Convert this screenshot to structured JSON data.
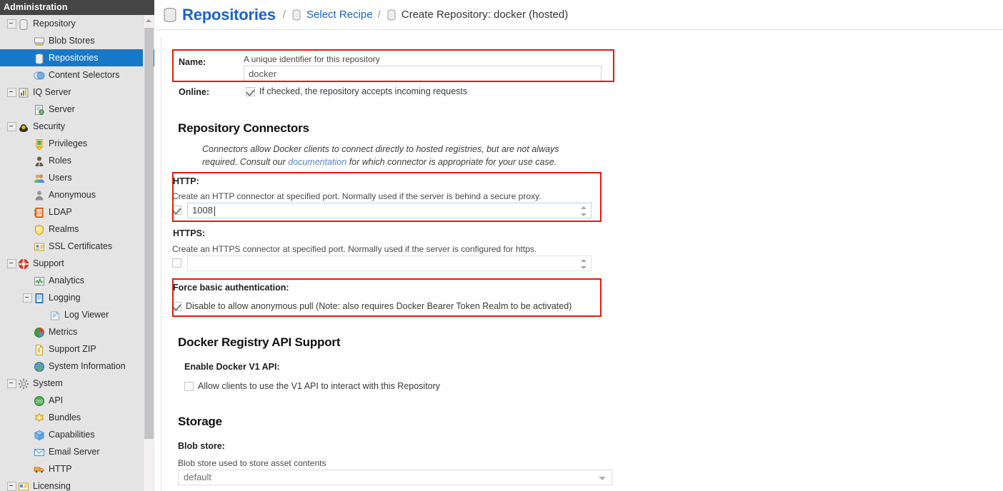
{
  "sidebar": {
    "header_title": "Administration",
    "items": [
      {
        "label": "Repository",
        "icon": "database-icon",
        "indent": 0,
        "twisty": "minus",
        "selected": false
      },
      {
        "label": "Blob Stores",
        "icon": "blob-store-icon",
        "indent": 1,
        "twisty": "none",
        "selected": false
      },
      {
        "label": "Repositories",
        "icon": "database-icon",
        "indent": 1,
        "twisty": "none",
        "selected": true
      },
      {
        "label": "Content Selectors",
        "icon": "content-selector-icon",
        "indent": 1,
        "twisty": "none",
        "selected": false
      },
      {
        "label": "IQ Server",
        "icon": "iq-server-icon",
        "indent": 0,
        "twisty": "minus",
        "selected": false
      },
      {
        "label": "Server",
        "icon": "server-icon",
        "indent": 1,
        "twisty": "none",
        "selected": false
      },
      {
        "label": "Security",
        "icon": "security-icon",
        "indent": 0,
        "twisty": "minus",
        "selected": false
      },
      {
        "label": "Privileges",
        "icon": "privileges-icon",
        "indent": 1,
        "twisty": "none",
        "selected": false
      },
      {
        "label": "Roles",
        "icon": "roles-icon",
        "indent": 1,
        "twisty": "none",
        "selected": false
      },
      {
        "label": "Users",
        "icon": "users-icon",
        "indent": 1,
        "twisty": "none",
        "selected": false
      },
      {
        "label": "Anonymous",
        "icon": "anonymous-icon",
        "indent": 1,
        "twisty": "none",
        "selected": false
      },
      {
        "label": "LDAP",
        "icon": "ldap-icon",
        "indent": 1,
        "twisty": "none",
        "selected": false
      },
      {
        "label": "Realms",
        "icon": "realms-icon",
        "indent": 1,
        "twisty": "none",
        "selected": false
      },
      {
        "label": "SSL Certificates",
        "icon": "ssl-certificate-icon",
        "indent": 1,
        "twisty": "none",
        "selected": false
      },
      {
        "label": "Support",
        "icon": "support-icon",
        "indent": 0,
        "twisty": "minus",
        "selected": false
      },
      {
        "label": "Analytics",
        "icon": "analytics-icon",
        "indent": 1,
        "twisty": "none",
        "selected": false
      },
      {
        "label": "Logging",
        "icon": "logging-icon",
        "indent": 1,
        "twisty": "minus",
        "selected": false
      },
      {
        "label": "Log Viewer",
        "icon": "log-viewer-icon",
        "indent": 2,
        "twisty": "none",
        "selected": false
      },
      {
        "label": "Metrics",
        "icon": "metrics-icon",
        "indent": 1,
        "twisty": "none",
        "selected": false
      },
      {
        "label": "Support ZIP",
        "icon": "support-zip-icon",
        "indent": 1,
        "twisty": "none",
        "selected": false
      },
      {
        "label": "System Information",
        "icon": "system-information-icon",
        "indent": 1,
        "twisty": "none",
        "selected": false
      },
      {
        "label": "System",
        "icon": "system-icon",
        "indent": 0,
        "twisty": "minus",
        "selected": false
      },
      {
        "label": "API",
        "icon": "api-icon",
        "indent": 1,
        "twisty": "none",
        "selected": false
      },
      {
        "label": "Bundles",
        "icon": "bundles-icon",
        "indent": 1,
        "twisty": "none",
        "selected": false
      },
      {
        "label": "Capabilities",
        "icon": "capabilities-icon",
        "indent": 1,
        "twisty": "none",
        "selected": false
      },
      {
        "label": "Email Server",
        "icon": "email-server-icon",
        "indent": 1,
        "twisty": "none",
        "selected": false
      },
      {
        "label": "HTTP",
        "icon": "http-icon",
        "indent": 1,
        "twisty": "none",
        "selected": false
      },
      {
        "label": "Licensing",
        "icon": "licensing-icon",
        "indent": 0,
        "twisty": "minus",
        "selected": false
      }
    ]
  },
  "breadcrumb": {
    "title": "Repositories",
    "sep": "/",
    "link_label": "Select Recipe",
    "current_label": "Create Repository: docker (hosted)"
  },
  "form": {
    "name": {
      "label": "Name:",
      "hint": "A unique identifier for this repository",
      "value": "docker",
      "placeholder": ""
    },
    "online": {
      "label": "Online:",
      "checkbox_text": "If checked, the repository accepts incoming requests",
      "checked": true
    },
    "connectors": {
      "heading": "Repository Connectors",
      "note_part1": "Connectors allow Docker clients to connect directly to hosted registries, but are not always required. Consult our ",
      "note_link": "documentation",
      "note_part2": " for which connector is appropriate for your use case.",
      "http": {
        "label": "HTTP:",
        "hint": "Create an HTTP connector at specified port. Normally used if the server is behind a secure proxy.",
        "checked": true,
        "value": "1008"
      },
      "https": {
        "label": "HTTPS:",
        "hint": "Create an HTTPS connector at specified port. Normally used if the server is configured for https.",
        "checked": false,
        "value": ""
      },
      "force_basic_auth": {
        "label": "Force basic authentication:",
        "checkbox_text": "Disable to allow anonymous pull (Note: also requires Docker Bearer Token Realm to be activated)",
        "checked": true
      }
    },
    "docker_api": {
      "heading": "Docker Registry API Support",
      "v1": {
        "label": "Enable Docker V1 API:",
        "checkbox_text": "Allow clients to use the V1 API to interact with this Repository",
        "checked": false
      }
    },
    "storage": {
      "heading": "Storage",
      "blob_store": {
        "label": "Blob store:",
        "hint": "Blob store used to store asset contents",
        "value": "default"
      }
    }
  },
  "colors": {
    "accent_blue": "#1b63c8",
    "selection_blue": "#1878c8",
    "highlight_red": "#e01b10",
    "header_dark": "#454545"
  }
}
